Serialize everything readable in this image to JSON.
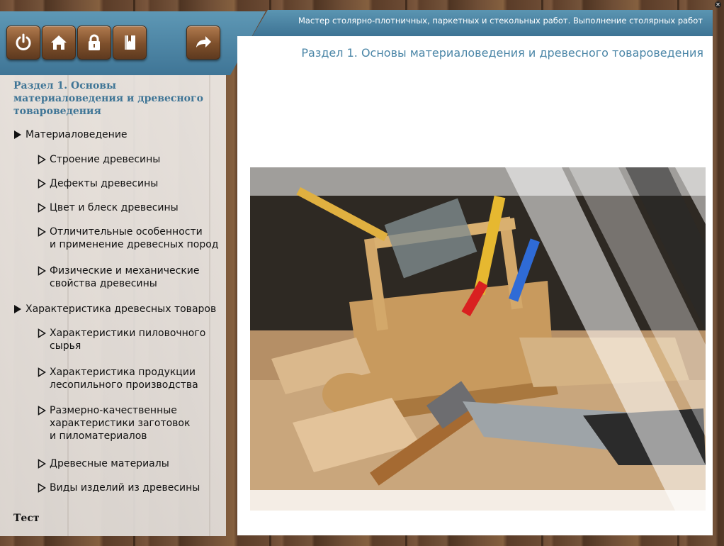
{
  "toolbar": {
    "buttons": [
      {
        "name": "power-button",
        "icon": "power-icon"
      },
      {
        "name": "home-button",
        "icon": "home-icon"
      },
      {
        "name": "lock-button",
        "icon": "lock-icon"
      },
      {
        "name": "book-button",
        "icon": "book-icon"
      },
      {
        "name": "next-button",
        "icon": "arrow-right-icon"
      }
    ]
  },
  "header": {
    "title": "Мастер столярно-плотничных, паркетных и стекольных работ. Выполнение столярных работ",
    "close_label": "✕"
  },
  "content": {
    "section_heading": "Раздел 1. Основы материаловедения и древесного товароведения",
    "image_icon": "carpentry-toolbox-image"
  },
  "nav": {
    "title": "Раздел 1. Основы материаловедения и древесного товароведения",
    "items": [
      {
        "label": "Материаловедение",
        "level": 1
      },
      {
        "label": "Строение древесины",
        "level": 2
      },
      {
        "label": "Дефекты древесины",
        "level": 2
      },
      {
        "label": "Цвет и блеск древесины",
        "level": 2
      },
      {
        "label": "Отличительные особенности\nи применение древесных пород",
        "level": 2
      },
      {
        "label": "Физические и механические\nсвойства древесины",
        "level": 2
      },
      {
        "label": "Характеристика древесных товаров",
        "level": 1
      },
      {
        "label": "Характеристики пиловочного\nсырья",
        "level": 2
      },
      {
        "label": "Характеристика продукции\nлесопильного производства",
        "level": 2
      },
      {
        "label": "Размерно-качественные\nхарактеристики заготовок\nи пиломатериалов",
        "level": 2
      },
      {
        "label": "Древесные материалы",
        "level": 2
      },
      {
        "label": "Виды изделий из древесины",
        "level": 2
      }
    ],
    "test_label": "Тест"
  },
  "colors": {
    "accent_blue": "#3f7596",
    "heading_blue": "#4b86a7",
    "wood_button": "#7d4f2b"
  }
}
